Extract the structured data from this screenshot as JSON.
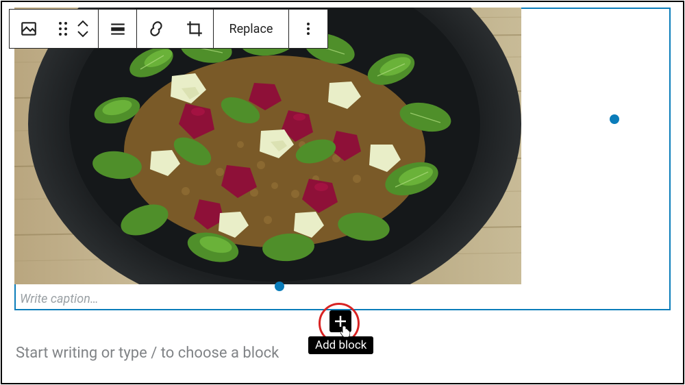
{
  "toolbar": {
    "image_icon": "image",
    "drag_icon": "drag",
    "move_up": "move-up",
    "move_down": "move-down",
    "align_label": "align",
    "link_label": "link",
    "crop_label": "crop",
    "replace_label": "Replace",
    "more_label": "more"
  },
  "image_block": {
    "alt": "Salad with greens, beets, apple cubes and lentils in a dark bowl on woodgrain surface",
    "caption_placeholder": "Write caption…"
  },
  "paragraph_prompt": "Start writing or type / to choose a block",
  "add_block": {
    "tooltip": "Add block",
    "icon_label": "plus"
  },
  "colors": {
    "selection": "#0a7cba",
    "highlight_ring": "#d82323"
  }
}
